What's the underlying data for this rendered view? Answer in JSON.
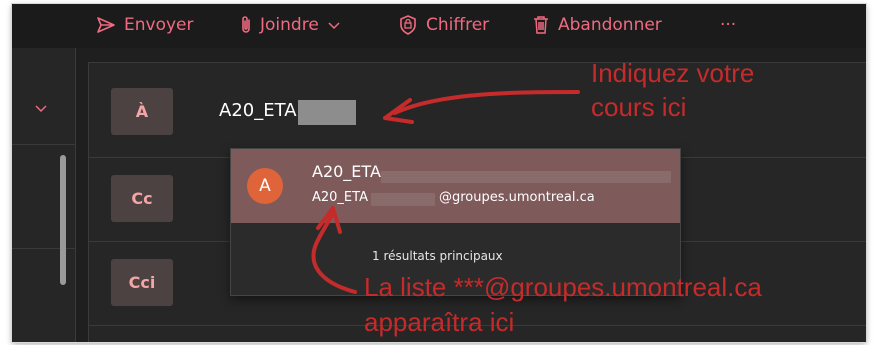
{
  "toolbar": {
    "send_label": "Envoyer",
    "attach_label": "Joindre",
    "encrypt_label": "Chiffrer",
    "discard_label": "Abandonner",
    "more_label": "···"
  },
  "compose": {
    "to_button": "À",
    "cc_button": "Cc",
    "bcc_button": "Cci",
    "to_value": "A20_ETA"
  },
  "suggestions": {
    "items": [
      {
        "avatar_letter": "A",
        "name": "A20_ETA",
        "email_prefix": "A20_ETA",
        "email_domain": "@groupes.umontreal.ca"
      }
    ],
    "results_text": "1 résultats principaux"
  },
  "annotations": {
    "course_hint_line1": "Indiquez   votre",
    "course_hint_line2": "cours ici",
    "list_hint_line1": "La liste ***@groupes.umontreal.ca",
    "list_hint_line2": "apparaîtra ici"
  },
  "colors": {
    "accent": "#f06a80",
    "annotation_red": "#c52b2b",
    "avatar": "#e0643a",
    "selected_suggestion": "#7f5a5b"
  },
  "icons": [
    "send-icon",
    "paperclip-icon",
    "chevron-down-icon",
    "encrypt-shield-icon",
    "trash-icon",
    "more-icon"
  ]
}
